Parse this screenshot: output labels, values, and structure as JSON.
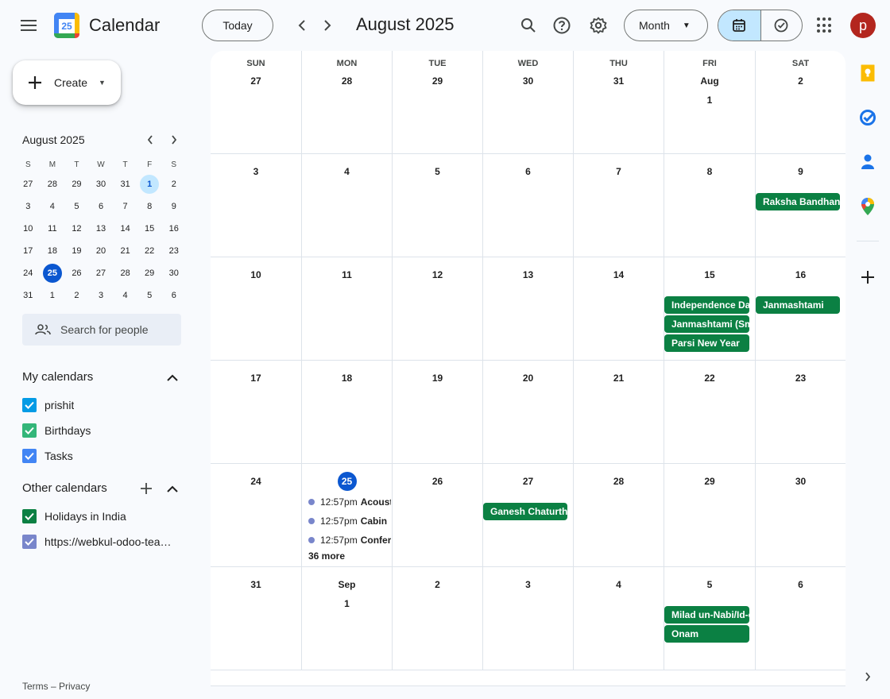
{
  "header": {
    "app_title": "Calendar",
    "logo_number": "25",
    "today_label": "Today",
    "month_title": "August 2025",
    "view_label": "Month",
    "avatar_letter": "p",
    "icons": [
      "menu-icon",
      "chevron-left-icon",
      "chevron-right-icon",
      "search-icon",
      "help-icon",
      "settings-icon",
      "calendar-icon",
      "tasks-icon",
      "apps-icon"
    ]
  },
  "sidebar": {
    "create_label": "Create",
    "mini_calendar": {
      "title": "August 2025",
      "weekday_headers": [
        "S",
        "M",
        "T",
        "W",
        "T",
        "F",
        "S"
      ],
      "weeks": [
        [
          "27",
          "28",
          "29",
          "30",
          "31",
          "1",
          "2"
        ],
        [
          "3",
          "4",
          "5",
          "6",
          "7",
          "8",
          "9"
        ],
        [
          "10",
          "11",
          "12",
          "13",
          "14",
          "15",
          "16"
        ],
        [
          "17",
          "18",
          "19",
          "20",
          "21",
          "22",
          "23"
        ],
        [
          "24",
          "25",
          "26",
          "27",
          "28",
          "29",
          "30"
        ],
        [
          "31",
          "1",
          "2",
          "3",
          "4",
          "5",
          "6"
        ]
      ],
      "today": "25",
      "selected": "1"
    },
    "search_people_placeholder": "Search for people",
    "my_calendars": {
      "title": "My calendars",
      "items": [
        {
          "name": "prishit",
          "color": "#039be5"
        },
        {
          "name": "Birthdays",
          "color": "#33b679"
        },
        {
          "name": "Tasks",
          "color": "#4285f4"
        }
      ]
    },
    "other_calendars": {
      "title": "Other calendars",
      "items": [
        {
          "name": "Holidays in India",
          "color": "#0b8043"
        },
        {
          "name": "https://webkul-odoo-tea…",
          "color": "#7986cb"
        }
      ]
    },
    "footer": "Terms – Privacy"
  },
  "month_grid": {
    "weekday_headers": [
      "SUN",
      "MON",
      "TUE",
      "WED",
      "THU",
      "FRI",
      "SAT"
    ],
    "weeks": [
      {
        "days": [
          "27",
          "28",
          "29",
          "30",
          "31",
          "Aug 1",
          "2"
        ]
      },
      {
        "days": [
          "3",
          "4",
          "5",
          "6",
          "7",
          "8",
          "9"
        ]
      },
      {
        "days": [
          "10",
          "11",
          "12",
          "13",
          "14",
          "15",
          "16"
        ]
      },
      {
        "days": [
          "17",
          "18",
          "19",
          "20",
          "21",
          "22",
          "23"
        ]
      },
      {
        "days": [
          "24",
          "25",
          "26",
          "27",
          "28",
          "29",
          "30"
        ]
      },
      {
        "days": [
          "31",
          "Sep 1",
          "2",
          "3",
          "4",
          "5",
          "6"
        ]
      }
    ],
    "events": {
      "raksha": "Raksha Bandhan",
      "independence": "Independence Day",
      "janmashtami_s": "Janmashtami (Smarta)",
      "parsi": "Parsi New Year",
      "janmashtami": "Janmashtami",
      "ganesh": "Ganesh Chaturthi",
      "milad": "Milad un-Nabi/Id-e-Milad",
      "onam": "Onam"
    },
    "timed_events": [
      {
        "time": "12:57pm",
        "title": "Acoustics"
      },
      {
        "time": "12:57pm",
        "title": "Cabin"
      },
      {
        "time": "12:57pm",
        "title": "Conference"
      }
    ],
    "more_label": "36 more",
    "event_color": "#0b8043",
    "today_color": "#0b57d0"
  },
  "right_rail": {
    "icons": [
      "keep-icon",
      "tasks-icon",
      "contacts-icon",
      "maps-icon",
      "add-icon",
      "expand-icon"
    ]
  }
}
